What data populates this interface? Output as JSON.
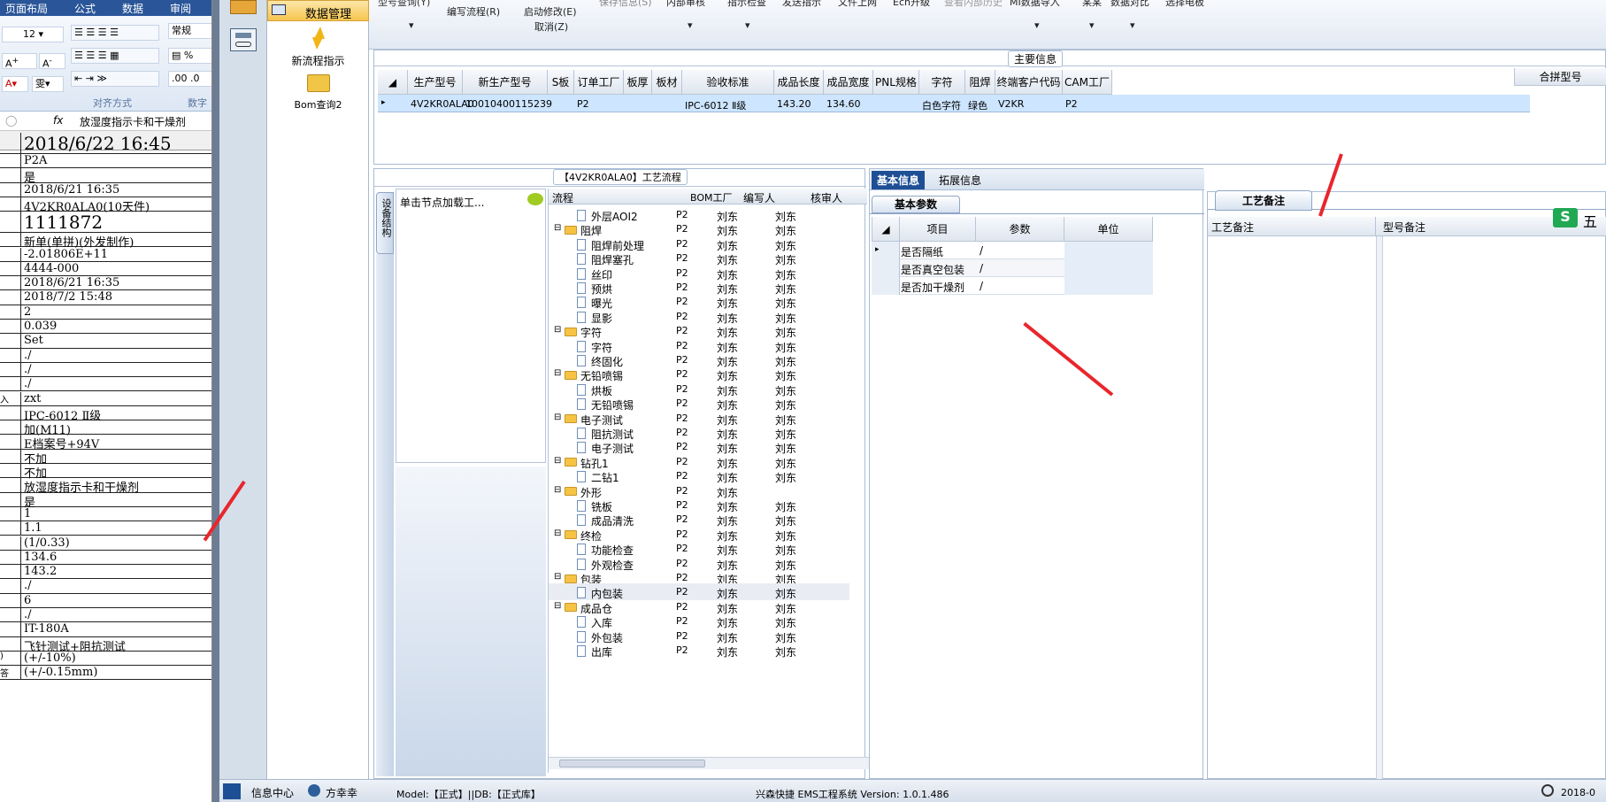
{
  "excel": {
    "tabs": [
      "页面布局",
      "公式",
      "数据",
      "审阅"
    ],
    "font_size": "12",
    "number_format": "常规",
    "group_align": "对齐方式",
    "group_num": "数字",
    "formula_fx": "fx",
    "formula_value": "放湿度指示卡和干燥剂",
    "rows": [
      {
        "h": "",
        "v": "2018/6/22 16:45",
        "big": true
      },
      {
        "h": "",
        "v": "P2A"
      },
      {
        "h": "",
        "v": "是"
      },
      {
        "h": "",
        "v": "2018/6/21 16:35"
      },
      {
        "h": "",
        "v": "4V2KR0ALA0(10天件)"
      },
      {
        "h": "",
        "v": "1111872",
        "big": true
      },
      {
        "h": "",
        "v": "新单(单拼)(外发制作)"
      },
      {
        "h": "",
        "v": "-2.01806E+11"
      },
      {
        "h": "",
        "v": "4444-000"
      },
      {
        "h": "",
        "v": "2018/6/21 16:35"
      },
      {
        "h": "",
        "v": "2018/7/2 15:48"
      },
      {
        "h": "",
        "v": "2"
      },
      {
        "h": "",
        "v": "0.039"
      },
      {
        "h": "",
        "v": "Set"
      },
      {
        "h": "",
        "v": "./"
      },
      {
        "h": "",
        "v": "./"
      },
      {
        "h": "",
        "v": "./"
      },
      {
        "h": "入",
        "v": "zxt"
      },
      {
        "h": "",
        "v": "IPC-6012 Ⅱ级"
      },
      {
        "h": "",
        "v": "加(M11)"
      },
      {
        "h": "",
        "v": "E档案号+94V"
      },
      {
        "h": "",
        "v": "不加"
      },
      {
        "h": "",
        "v": "不加"
      },
      {
        "h": "",
        "v": "放湿度指示卡和干燥剂"
      },
      {
        "h": "",
        "v": "是"
      },
      {
        "h": "",
        "v": "1"
      },
      {
        "h": "",
        "v": "1.1"
      },
      {
        "h": "",
        "v": "(1/0.33)"
      },
      {
        "h": "",
        "v": "134.6"
      },
      {
        "h": "",
        "v": "143.2"
      },
      {
        "h": "",
        "v": "./"
      },
      {
        "h": "",
        "v": "6"
      },
      {
        "h": "",
        "v": "./"
      },
      {
        "h": "",
        "v": "IT-180A"
      },
      {
        "h": "",
        "v": "飞针测试+阻抗测试"
      },
      {
        "h": ")",
        "v": "(+/-10%)"
      },
      {
        "h": "答",
        "v": "(+/-0.15mm)"
      }
    ]
  },
  "nav": {
    "header": "数据管理",
    "items": [
      "新流程指示",
      "Bom查询2"
    ]
  },
  "toolbar": {
    "items": [
      "编写流程(R)",
      "启动修改(E)",
      "取消(Z)"
    ],
    "faded": [
      "型号查询(Y)",
      "保存信息(S)",
      "内部审核",
      "指示检查",
      "发送指示",
      "文件上网",
      "Ecn升级",
      "查看内部历史",
      "MI数据导入",
      "某某",
      "数据对比",
      "选择电板"
    ]
  },
  "main": {
    "title": "主要信息",
    "columns": [
      "生产型号",
      "新生产型号",
      "S板",
      "订单工厂",
      "板厚",
      "板材",
      "验收标准",
      "成品长度",
      "成品宽度",
      "PNL规格",
      "字符",
      "阻焊",
      "终端客户代码",
      "CAM工厂"
    ],
    "row": [
      "4V2KR0ALA0",
      "10010400115239",
      "",
      "P2",
      "",
      "",
      "IPC-6012 Ⅱ级",
      "143.20",
      "134.60",
      "",
      "白色字符",
      "绿色",
      "V2KR",
      "P2"
    ],
    "side_col": "合拼型号"
  },
  "flow": {
    "title": "【4V2KR0ALA0】工艺流程",
    "vtab": "设备结构",
    "hint": "单击节点加载工...",
    "headers": [
      "流程",
      "BOM工厂",
      "编写人",
      "核审人"
    ],
    "rows": [
      {
        "lvl": 2,
        "name": "外层AOI2",
        "bom": "P2",
        "w": "刘东",
        "r": "刘东"
      },
      {
        "lvl": 1,
        "name": "阻焊",
        "bom": "P2",
        "w": "刘东",
        "r": "刘东"
      },
      {
        "lvl": 2,
        "name": "阻焊前处理",
        "bom": "P2",
        "w": "刘东",
        "r": "刘东"
      },
      {
        "lvl": 2,
        "name": "阻焊塞孔",
        "bom": "P2",
        "w": "刘东",
        "r": "刘东"
      },
      {
        "lvl": 2,
        "name": "丝印",
        "bom": "P2",
        "w": "刘东",
        "r": "刘东"
      },
      {
        "lvl": 2,
        "name": "预烘",
        "bom": "P2",
        "w": "刘东",
        "r": "刘东"
      },
      {
        "lvl": 2,
        "name": "曝光",
        "bom": "P2",
        "w": "刘东",
        "r": "刘东"
      },
      {
        "lvl": 2,
        "name": "显影",
        "bom": "P2",
        "w": "刘东",
        "r": "刘东"
      },
      {
        "lvl": 1,
        "name": "字符",
        "bom": "P2",
        "w": "刘东",
        "r": "刘东"
      },
      {
        "lvl": 2,
        "name": "字符",
        "bom": "P2",
        "w": "刘东",
        "r": "刘东"
      },
      {
        "lvl": 2,
        "name": "终固化",
        "bom": "P2",
        "w": "刘东",
        "r": "刘东"
      },
      {
        "lvl": 1,
        "name": "无铅喷锡",
        "bom": "P2",
        "w": "刘东",
        "r": "刘东"
      },
      {
        "lvl": 2,
        "name": "烘板",
        "bom": "P2",
        "w": "刘东",
        "r": "刘东"
      },
      {
        "lvl": 2,
        "name": "无铅喷锡",
        "bom": "P2",
        "w": "刘东",
        "r": "刘东"
      },
      {
        "lvl": 1,
        "name": "电子测试",
        "bom": "P2",
        "w": "刘东",
        "r": "刘东"
      },
      {
        "lvl": 2,
        "name": "阻抗测试",
        "bom": "P2",
        "w": "刘东",
        "r": "刘东"
      },
      {
        "lvl": 2,
        "name": "电子测试",
        "bom": "P2",
        "w": "刘东",
        "r": "刘东"
      },
      {
        "lvl": 1,
        "name": "钻孔1",
        "bom": "P2",
        "w": "刘东",
        "r": "刘东"
      },
      {
        "lvl": 2,
        "name": "二钻1",
        "bom": "P2",
        "w": "刘东",
        "r": "刘东"
      },
      {
        "lvl": 1,
        "name": "外形",
        "bom": "P2",
        "w": "刘东",
        "r": ""
      },
      {
        "lvl": 2,
        "name": "铣板",
        "bom": "P2",
        "w": "刘东",
        "r": "刘东"
      },
      {
        "lvl": 2,
        "name": "成品清洗",
        "bom": "P2",
        "w": "刘东",
        "r": "刘东"
      },
      {
        "lvl": 1,
        "name": "终检",
        "bom": "P2",
        "w": "刘东",
        "r": "刘东"
      },
      {
        "lvl": 2,
        "name": "功能检查",
        "bom": "P2",
        "w": "刘东",
        "r": "刘东"
      },
      {
        "lvl": 2,
        "name": "外观检查",
        "bom": "P2",
        "w": "刘东",
        "r": "刘东"
      },
      {
        "lvl": 1,
        "name": "包装",
        "bom": "P2",
        "w": "刘东",
        "r": "刘东"
      },
      {
        "lvl": 2,
        "name": "内包装",
        "bom": "P2",
        "w": "刘东",
        "r": "刘东",
        "sel": true
      },
      {
        "lvl": 1,
        "name": "成品仓",
        "bom": "P2",
        "w": "刘东",
        "r": "刘东"
      },
      {
        "lvl": 2,
        "name": "入库",
        "bom": "P2",
        "w": "刘东",
        "r": "刘东"
      },
      {
        "lvl": 2,
        "name": "外包装",
        "bom": "P2",
        "w": "刘东",
        "r": "刘东"
      },
      {
        "lvl": 2,
        "name": "出库",
        "bom": "P2",
        "w": "刘东",
        "r": "刘东"
      }
    ]
  },
  "basic": {
    "tabs": [
      "基本信息",
      "拓展信息"
    ],
    "subtab": "基本参数",
    "headers": [
      "项目",
      "参数",
      "单位"
    ],
    "rows": [
      {
        "item": "是否隔纸",
        "param": "/",
        "unit": ""
      },
      {
        "item": "是否真空包装",
        "param": "/",
        "unit": ""
      },
      {
        "item": "是否加干燥剂",
        "param": "/",
        "unit": ""
      }
    ]
  },
  "remark": {
    "tab": "工艺备注",
    "col1": "工艺备注",
    "col2": "型号备注",
    "ime": "五"
  },
  "status": {
    "center": "信息中心",
    "user": "方幸幸",
    "model": "Model:【正式】||DB:【正式库】",
    "app": "兴森快捷 EMS工程系统 Version: 1.0.1.486",
    "date": "2018-0"
  },
  "colors": {
    "accent": "#1e4f95",
    "arrow": "#e8262c",
    "selected": "#cde5ff"
  }
}
